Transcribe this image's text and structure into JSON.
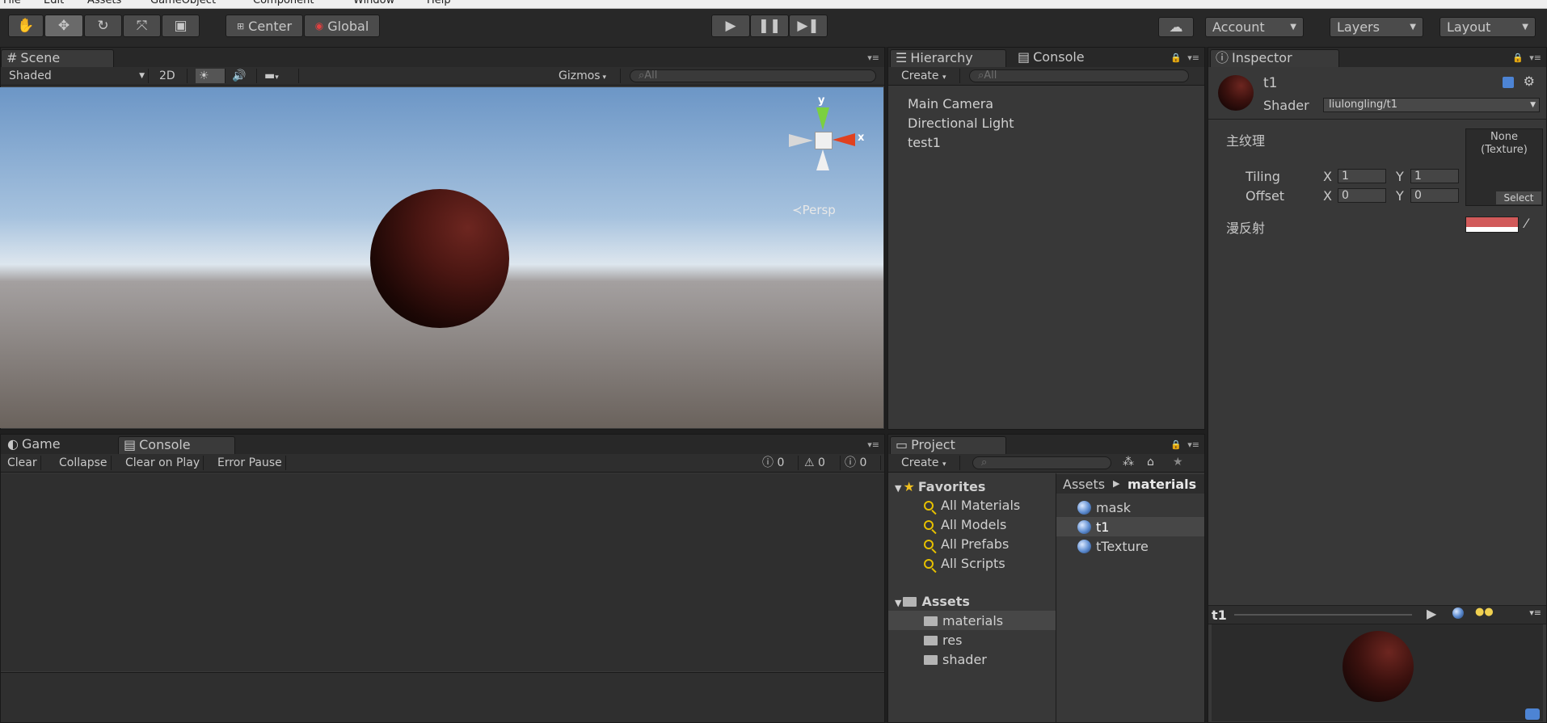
{
  "menubar": {
    "items": [
      "File",
      "Edit",
      "Assets",
      "GameObject",
      "Component",
      "Window",
      "Help"
    ]
  },
  "toolbar": {
    "tools": [
      "hand-icon",
      "move-icon",
      "rotate-icon",
      "scale-icon",
      "rect-icon"
    ],
    "pivot_center": "Center",
    "pivot_global": "Global",
    "account": "Account",
    "layers": "Layers",
    "layout": "Layout"
  },
  "scene": {
    "tab": "Scene",
    "shading": "Shaded",
    "mode_2d": "2D",
    "gizmos": "Gizmos",
    "search_placeholder": "All",
    "gizmo_y": "y",
    "gizmo_x": "x",
    "persp": "Persp"
  },
  "hierarchy": {
    "tab": "Hierarchy",
    "tab2": "Console",
    "create": "Create",
    "search_placeholder": "All",
    "items": [
      "Main Camera",
      "Directional Light",
      "test1"
    ]
  },
  "inspector": {
    "tab": "Inspector",
    "name": "t1",
    "shader_label": "Shader",
    "shader_value": "liulongling/t1",
    "main_texture_label": "主纹理",
    "texture_none": "None",
    "texture_type": "(Texture)",
    "select": "Select",
    "tiling_label": "Tiling",
    "offset_label": "Offset",
    "x": "X",
    "y": "Y",
    "tiling_x": "1",
    "tiling_y": "1",
    "offset_x": "0",
    "offset_y": "0",
    "diffuse_label": "漫反射",
    "diffuse_color": "#d15a5a",
    "preview_name": "t1"
  },
  "console": {
    "tab_game": "Game",
    "tab_console": "Console",
    "buttons": [
      "Clear",
      "Collapse",
      "Clear on Play",
      "Error Pause"
    ],
    "count_errors": "0",
    "count_warnings": "0",
    "count_info": "0"
  },
  "project": {
    "tab": "Project",
    "create": "Create",
    "favorites_label": "Favorites",
    "favorites": [
      "All Materials",
      "All Models",
      "All Prefabs",
      "All Scripts"
    ],
    "assets_label": "Assets",
    "folders": [
      "materials",
      "res",
      "shader"
    ],
    "breadcrumb_root": "Assets",
    "breadcrumb_current": "materials",
    "files": [
      "mask",
      "t1",
      "tTexture"
    ]
  }
}
